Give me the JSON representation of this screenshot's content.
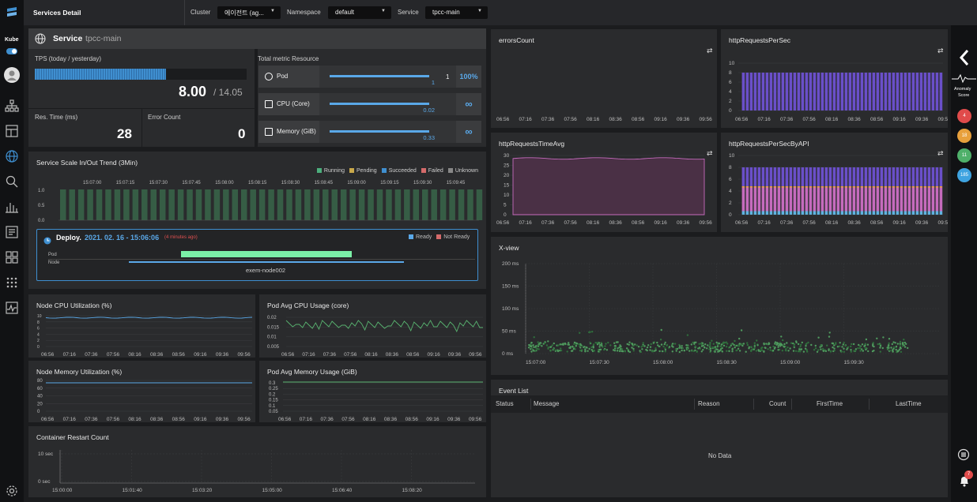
{
  "header": {
    "title": "Services Detail",
    "cluster_label": "Cluster",
    "cluster_value": "에이전트 (ag...",
    "namespace_label": "Namespace",
    "namespace_value": "default",
    "service_label": "Service",
    "service_value": "tpcc-main"
  },
  "sidebar": {
    "kube_label": "Kube",
    "icons": [
      "topology-icon",
      "layout-icon",
      "globe-icon",
      "search-icon",
      "bar-chart-icon",
      "report-icon",
      "grid-icon",
      "apps-icon",
      "monitor-icon",
      "settings-icon"
    ]
  },
  "service": {
    "label": "Service",
    "name": "tpcc-main"
  },
  "tps": {
    "label": "TPS (today / yesterday)",
    "today": "8.00",
    "yesterday": "/ 14.05",
    "fill": 0.62
  },
  "res_time": {
    "label": "Res. Time (ms)",
    "value": "28"
  },
  "error_count": {
    "label": "Error Count",
    "value": "0"
  },
  "total_metric": {
    "title": "Total metric Resource",
    "rows": [
      {
        "label": "Pod",
        "value": "1",
        "extra": "1",
        "right": "100%",
        "fill": 1.0,
        "icon": "pod-icon"
      },
      {
        "label": "CPU (Core)",
        "value": "0.02",
        "extra": "",
        "right": "∞",
        "fill": 1.0,
        "icon": "cpu-icon"
      },
      {
        "label": "Memory (GiB)",
        "value": "0.33",
        "extra": "",
        "right": "∞",
        "fill": 1.0,
        "icon": "memory-icon"
      }
    ]
  },
  "scale": {
    "title": "Service Scale In/Out Trend (3Min)",
    "legend": [
      {
        "label": "Running",
        "color": "#4caf7d"
      },
      {
        "label": "Pending",
        "color": "#c8a84a"
      },
      {
        "label": "Succeeded",
        "color": "#3f8fd0"
      },
      {
        "label": "Failed",
        "color": "#d46a6a"
      },
      {
        "label": "Unknown",
        "color": "#888888"
      }
    ],
    "x_ticks": [
      "15:07:00",
      "15:07:15",
      "15:07:30",
      "15:07:45",
      "15:08:00",
      "15:08:15",
      "15:08:30",
      "15:08:45",
      "15:09:00",
      "15:09:15",
      "15:09:30",
      "15:09:45"
    ],
    "y_ticks": [
      "1.0",
      "0.5",
      "0.0"
    ]
  },
  "deploy": {
    "label": "Deploy.",
    "date": "2021. 02. 16 - 15:06:06",
    "ago": "(4 minutes ago)",
    "ready": "Ready",
    "not_ready": "Not Ready",
    "pod_label": "Pod",
    "node_label": "Node",
    "node_name": "exem-node002"
  },
  "time_ticks": [
    "06:56",
    "07:16",
    "07:36",
    "07:56",
    "08:16",
    "08:36",
    "08:56",
    "09:16",
    "09:36",
    "09:56"
  ],
  "node_cpu": {
    "title": "Node CPU Utilization (%)",
    "y_ticks": [
      "10",
      "8",
      "6",
      "4",
      "2",
      "0"
    ]
  },
  "pod_cpu": {
    "title": "Pod Avg CPU Usage (core)",
    "y_ticks": [
      "0.02",
      "0.015",
      "0.01",
      "0.005"
    ]
  },
  "node_mem": {
    "title": "Node Memory Utilization (%)",
    "y_ticks": [
      "80",
      "60",
      "40",
      "20",
      "0"
    ]
  },
  "pod_mem": {
    "title": "Pod Avg Memory Usage (GiB)",
    "y_ticks": [
      "0.3",
      "0.25",
      "0.2",
      "0.15",
      "0.1",
      "0.05"
    ]
  },
  "restart": {
    "title": "Container Restart Count",
    "y_ticks": [
      "10 sec",
      "0 sec"
    ],
    "x_ticks": [
      "15:00:00",
      "15:01:40",
      "15:03:20",
      "15:05:00",
      "15:06:40",
      "15:08:20"
    ]
  },
  "errors": {
    "title": "errorsCount"
  },
  "req_per_sec": {
    "title": "httpRequestsPerSec",
    "y_ticks": [
      "10",
      "8",
      "6",
      "4",
      "2",
      "0"
    ]
  },
  "req_time": {
    "title": "httpRequestsTimeAvg",
    "y_ticks": [
      "30",
      "25",
      "20",
      "15",
      "10",
      "5",
      "0"
    ]
  },
  "req_api": {
    "title": "httpRequestsPerSecByAPI",
    "y_ticks": [
      "10",
      "8",
      "6",
      "4",
      "2",
      "0"
    ]
  },
  "xview": {
    "title": "X-view",
    "y_ticks": [
      "200 ms",
      "150 ms",
      "100 ms",
      "50 ms",
      "0 ms"
    ],
    "x_ticks": [
      "15:07:00",
      "15:07:30",
      "15:08:00",
      "15:08:30",
      "15:09:00",
      "15:09:30"
    ]
  },
  "events": {
    "title": "Event List",
    "columns": [
      "Status",
      "Message",
      "Reason",
      "Count",
      "FirstTime",
      "LastTime"
    ],
    "empty": "No Data"
  },
  "right_rail": {
    "anomaly_label": "Anomaly",
    "score_label": "Score",
    "badges": [
      {
        "value": "4",
        "color": "#e04b4b"
      },
      {
        "value": "18",
        "color": "#e8a03c"
      },
      {
        "value": "11",
        "color": "#4fb06a"
      },
      {
        "value": "185",
        "color": "#3fa3e0"
      }
    ],
    "notify_count": "7"
  },
  "colors": {
    "accent": "#3f8fd0",
    "bar_purple": "#6a4fc9",
    "pink": "#c56bbd",
    "green": "#58b26f"
  }
}
